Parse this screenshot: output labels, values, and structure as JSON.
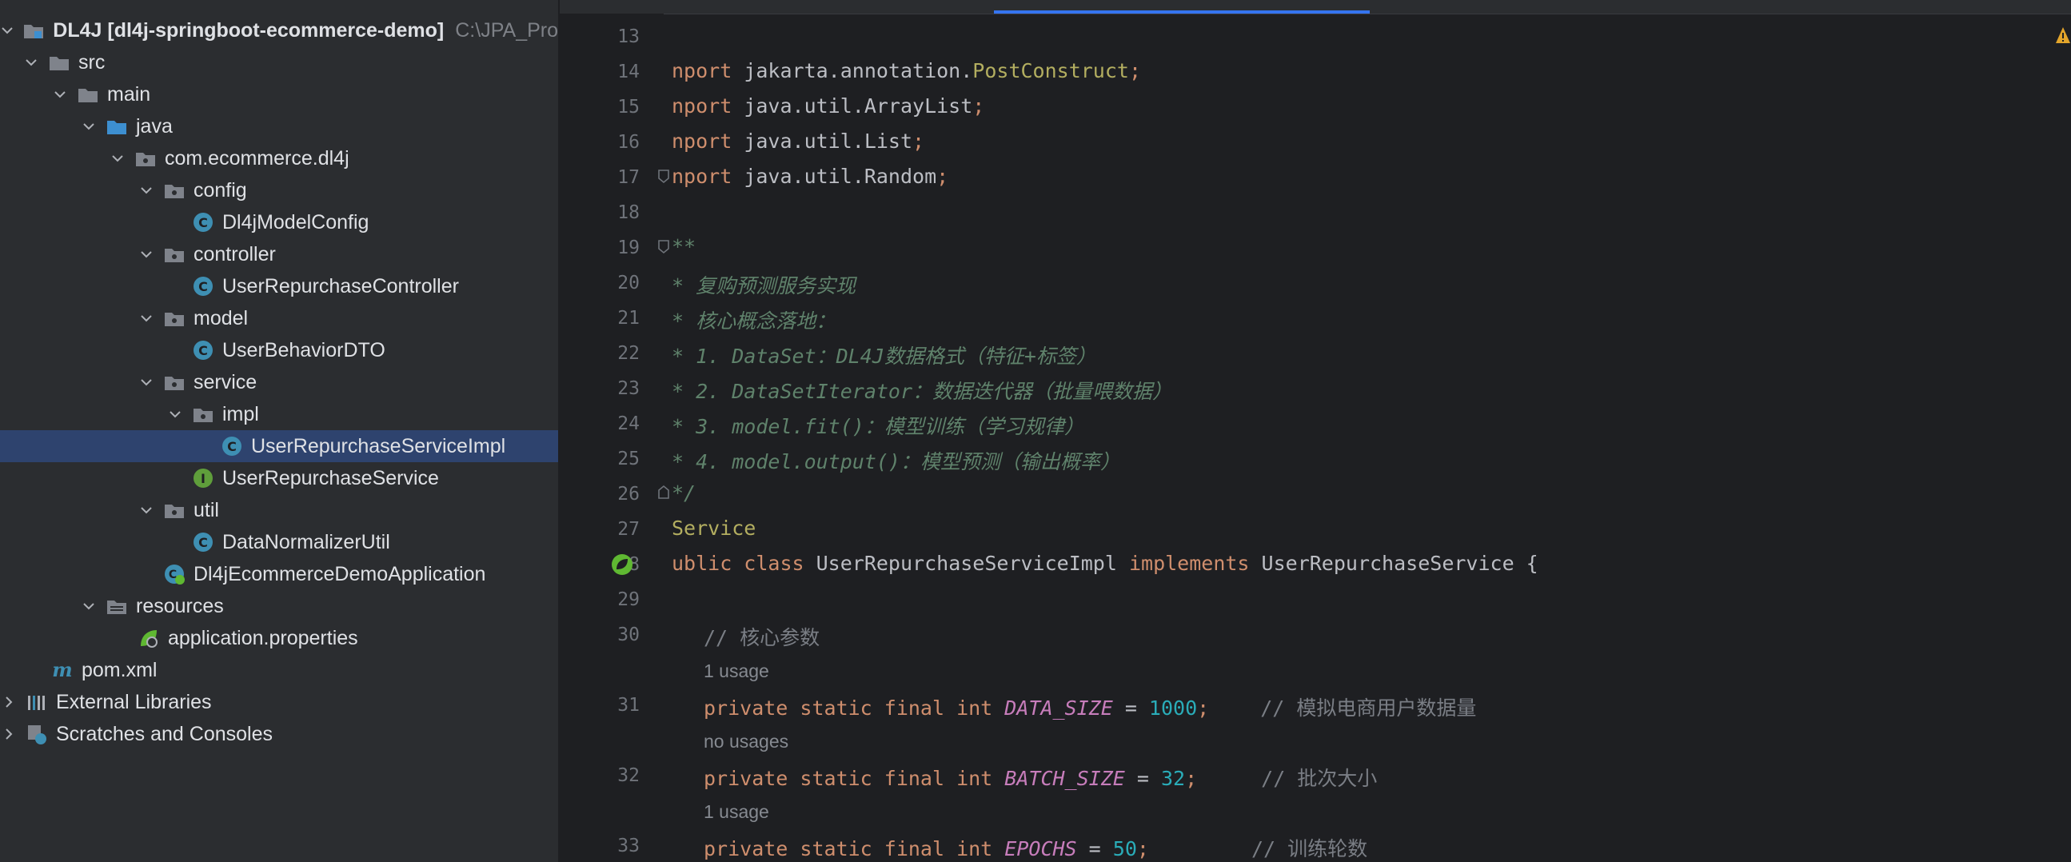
{
  "project": {
    "root_name": "DL4J",
    "root_module": "[dl4j-springboot-ecommerce-demo]",
    "root_path": "C:\\JPA_Pro",
    "items": [
      {
        "label": "src"
      },
      {
        "label": "main"
      },
      {
        "label": "java"
      },
      {
        "label": "com.ecommerce.dl4j"
      },
      {
        "label": "config"
      },
      {
        "label": "Dl4jModelConfig"
      },
      {
        "label": "controller"
      },
      {
        "label": "UserRepurchaseController"
      },
      {
        "label": "model"
      },
      {
        "label": "UserBehaviorDTO"
      },
      {
        "label": "service"
      },
      {
        "label": "impl"
      },
      {
        "label": "UserRepurchaseServiceImpl"
      },
      {
        "label": "UserRepurchaseService"
      },
      {
        "label": "util"
      },
      {
        "label": "DataNormalizerUtil"
      },
      {
        "label": "Dl4jEcommerceDemoApplication"
      },
      {
        "label": "resources"
      },
      {
        "label": "application.properties"
      },
      {
        "label": "pom.xml"
      },
      {
        "label": "External Libraries"
      },
      {
        "label": "Scratches and Consoles"
      }
    ]
  },
  "editor": {
    "line_numbers": [
      "13",
      "14",
      "15",
      "16",
      "17",
      "18",
      "19",
      "20",
      "21",
      "22",
      "23",
      "24",
      "25",
      "26",
      "27",
      "28",
      "29",
      "30",
      "31",
      "32",
      "33"
    ],
    "code": {
      "l14a": "nport ",
      "l14b": "jakarta.annotation.",
      "l14c": "PostConstruct",
      "l14d": ";",
      "l15a": "nport ",
      "l15b": "java.util.ArrayList",
      "l15c": ";",
      "l16a": "nport ",
      "l16b": "java.util.List",
      "l16c": ";",
      "l17a": "nport ",
      "l17b": "java.util.Random",
      "l17c": ";",
      "l19": "**",
      "l20": "* 复购预测服务实现",
      "l21": "* 核心概念落地：",
      "l22": "* 1. DataSet：DL4J数据格式（特征+标签）",
      "l23": "* 2. DataSetIterator：数据迭代器（批量喂数据）",
      "l24": "* 3. model.fit()：模型训练（学习规律）",
      "l25": "* 4. model.output()：模型预测（输出概率）",
      "l26": "*/",
      "l27": "Service",
      "l28a": "ublic class ",
      "l28b": "UserRepurchaseServiceImpl ",
      "l28c": "implements ",
      "l28d": "UserRepurchaseService {",
      "l30": "// 核心参数",
      "l31a": "private static final int ",
      "l31b": "DATA_SIZE",
      "l31c": " = ",
      "l31d": "1000",
      "l31e": ";",
      "l31f": "// 模拟电商用户数据量",
      "l32a": "private static final int ",
      "l32b": "BATCH_SIZE",
      "l32c": " = ",
      "l32d": "32",
      "l32e": ";",
      "l32f": "// 批次大小",
      "l33a": "private static final int ",
      "l33b": "EPOCHS",
      "l33c": " = ",
      "l33d": "50",
      "l33e": ";",
      "l33f": "// 训练轮数"
    },
    "hints": {
      "h31": "1 usage",
      "h32": "no usages",
      "h33": "1 usage"
    }
  },
  "colors": {
    "accent": "#3574f0",
    "selection": "#2e436e",
    "keyword": "#cf8e6d",
    "number": "#2aacb8",
    "constant": "#c77dbb",
    "doc_comment": "#5f826b"
  }
}
